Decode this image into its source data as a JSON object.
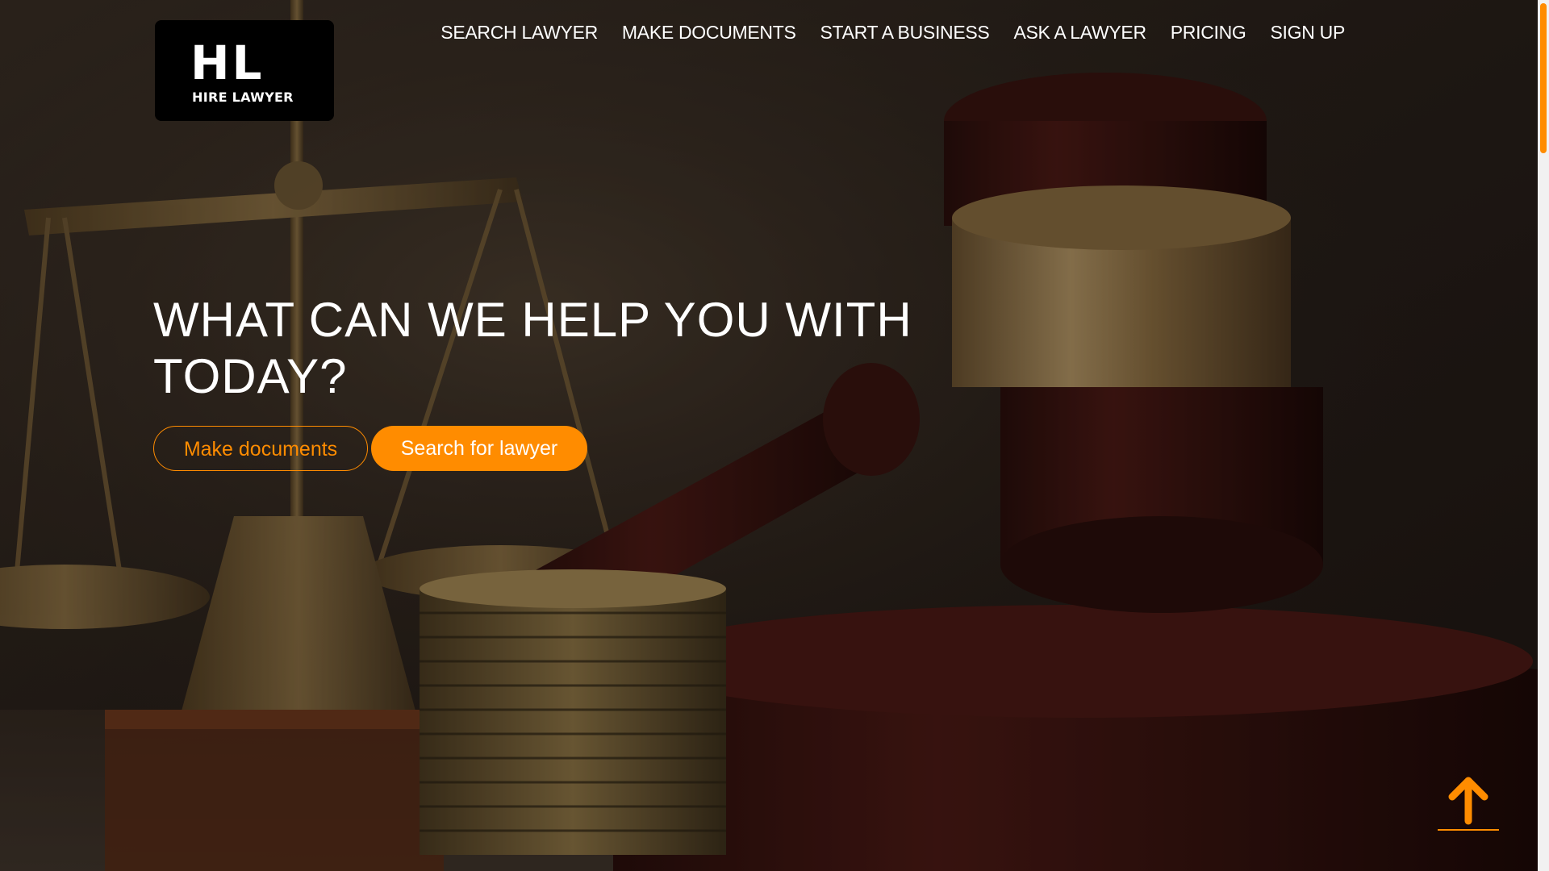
{
  "brand": {
    "mark": "HL",
    "name": "HIRE LAWYER"
  },
  "nav": {
    "items": [
      {
        "label": "SEARCH LAWYER"
      },
      {
        "label": "MAKE DOCUMENTS"
      },
      {
        "label": "START A BUSINESS"
      },
      {
        "label": "ASK A LAWYER"
      },
      {
        "label": "PRICING"
      },
      {
        "label": "SIGN UP"
      }
    ]
  },
  "hero": {
    "headline": "WHAT CAN WE HELP YOU WITH TODAY?",
    "primary_button": "Make documents",
    "secondary_button": "Search for lawyer"
  },
  "icons": {
    "back_to_top": "arrow-up-icon"
  },
  "colors": {
    "accent": "#ff8c00",
    "text": "#ffffff",
    "logo_bg": "#000000"
  }
}
